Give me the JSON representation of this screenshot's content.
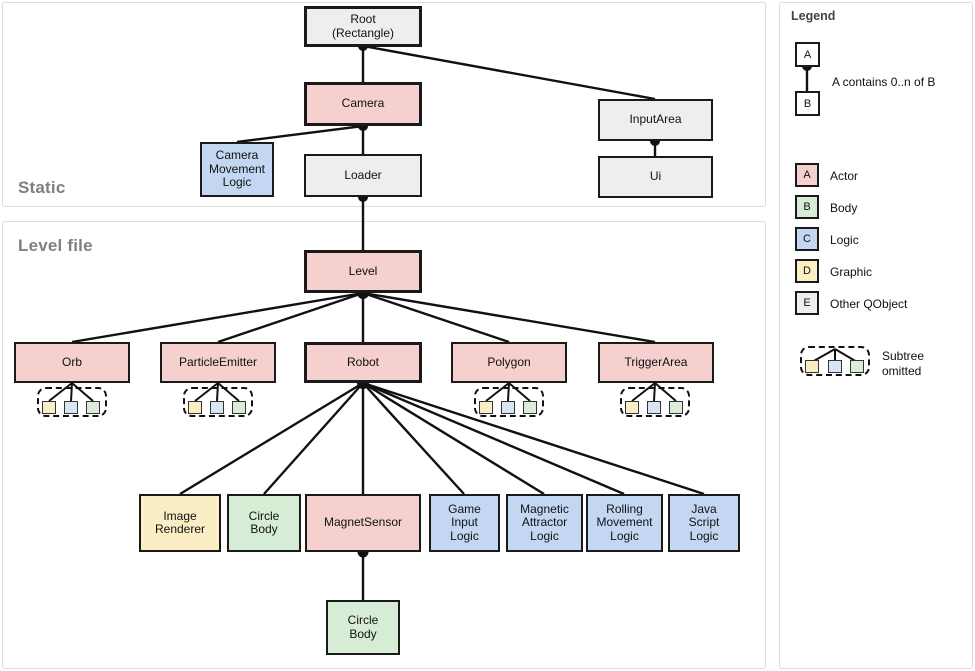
{
  "panels": {
    "static": {
      "title": "Static"
    },
    "level": {
      "title": "Level file"
    },
    "legend": {
      "title": "Legend"
    }
  },
  "legend": {
    "containment": {
      "parent": "A",
      "child": "B",
      "text": "A contains 0..n of B"
    },
    "categories": [
      {
        "letter": "A",
        "label": "Actor",
        "color": "#f6cfcf"
      },
      {
        "letter": "B",
        "label": "Body",
        "color": "#d7ecd5"
      },
      {
        "letter": "C",
        "label": "Logic",
        "color": "#c3d7f2"
      },
      {
        "letter": "D",
        "label": "Graphic",
        "color": "#faeec4"
      },
      {
        "letter": "E",
        "label": "Other QObject",
        "color": "#eeeeee"
      }
    ],
    "subtree": {
      "line1": "Subtree",
      "line2": "omitted"
    }
  },
  "nodes": {
    "root": {
      "label": "Root\n(Rectangle)",
      "kind": "other"
    },
    "camera": {
      "label": "Camera",
      "kind": "actor"
    },
    "input_area": {
      "label": "InputArea",
      "kind": "other"
    },
    "ui": {
      "label": "Ui",
      "kind": "other"
    },
    "camera_logic": {
      "label": "Camera\nMovement\nLogic",
      "kind": "logic"
    },
    "loader": {
      "label": "Loader",
      "kind": "other"
    },
    "level": {
      "label": "Level",
      "kind": "actor"
    },
    "orb": {
      "label": "Orb",
      "kind": "actor"
    },
    "particle": {
      "label": "ParticleEmitter",
      "kind": "actor"
    },
    "robot": {
      "label": "Robot",
      "kind": "actor"
    },
    "polygon": {
      "label": "Polygon",
      "kind": "actor"
    },
    "trigger": {
      "label": "TriggerArea",
      "kind": "actor"
    },
    "image_renderer": {
      "label": "Image\nRenderer",
      "kind": "graphic"
    },
    "circle_body": {
      "label": "Circle\nBody",
      "kind": "body"
    },
    "magnet_sensor": {
      "label": "MagnetSensor",
      "kind": "actor"
    },
    "game_input": {
      "label": "Game\nInput\nLogic",
      "kind": "logic"
    },
    "magnetic_attractor": {
      "label": "Magnetic\nAttractor\nLogic",
      "kind": "logic"
    },
    "rolling_movement": {
      "label": "Rolling\nMovement\nLogic",
      "kind": "logic"
    },
    "java_script": {
      "label": "Java\nScript\nLogic",
      "kind": "logic"
    },
    "circle_body_2": {
      "label": "Circle\nBody",
      "kind": "body"
    }
  },
  "colors": {
    "actor": "#f6cfcf",
    "body": "#d7ecd5",
    "logic": "#c3d7f2",
    "graphic": "#faeec4",
    "other": "#eeeeee",
    "stroke": "#1a1a1a",
    "panel_border": "#dcdcdc",
    "title": "#808080"
  }
}
